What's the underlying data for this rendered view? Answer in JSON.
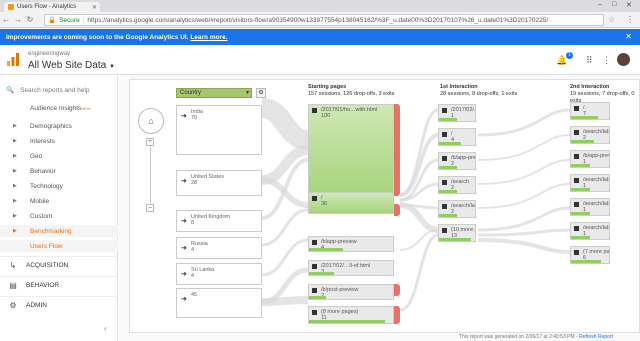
{
  "browser": {
    "tab_title": "Users Flow - Analytics",
    "secure_label": "Secure",
    "url": "https://analytics.google.com/analytics/web/#report/visitors-flow/a90354900w133977554p138045162/%3F_u.date00%3D20170107%26_u.date01%3D20170225/"
  },
  "banner": {
    "text": "Improvements are coming soon to the Google Analytics UI.",
    "link": "Learn more."
  },
  "header": {
    "account": "engineeringway",
    "property": "All Web Site Data",
    "notification_count": "1"
  },
  "sidebar": {
    "search_placeholder": "Search reports and help",
    "items": [
      {
        "label": "Audience Insights",
        "badge": "NEW"
      },
      {
        "label": "Demographics"
      },
      {
        "label": "Interests"
      },
      {
        "label": "Geo"
      },
      {
        "label": "Behavior"
      },
      {
        "label": "Technology"
      },
      {
        "label": "Mobile"
      },
      {
        "label": "Custom"
      },
      {
        "label": "Benchmarking"
      },
      {
        "label": "Users Flow"
      }
    ],
    "sections": [
      {
        "label": "ACQUISITION"
      },
      {
        "label": "BEHAVIOR"
      },
      {
        "label": "ADMIN"
      }
    ]
  },
  "flow": {
    "dimension": "Country",
    "countries": [
      {
        "name": "India",
        "value": "70"
      },
      {
        "name": "United States",
        "value": "28"
      },
      {
        "name": "United Kingdom",
        "value": "8"
      },
      {
        "name": "Russia",
        "value": "4"
      },
      {
        "name": "Sri Lanka",
        "value": "4"
      },
      {
        "name": "",
        "value": "45"
      }
    ],
    "starting": {
      "title": "Starting pages",
      "stats": "157 sessions, 126 drop-offs, 3 exits",
      "nodes": [
        {
          "label": "/2017/01/ho…with.html",
          "value": "100"
        },
        {
          "label": "/",
          "value": "36"
        },
        {
          "label": "/blapp-preview",
          "value": "4"
        },
        {
          "label": "/2017/02/…ll-of.html",
          "value": "3"
        },
        {
          "label": "/b/post-preview",
          "value": "2"
        },
        {
          "label": "(8 more pages)",
          "value": "11"
        }
      ]
    },
    "first": {
      "title": "1st Interaction",
      "stats": "28 sessions, 8 drop-offs, 1 exits",
      "nodes": [
        {
          "label": "/2017/02/…ll-of.html",
          "value": "1"
        },
        {
          "label": "/",
          "value": "4"
        },
        {
          "label": "/b/app-preview",
          "value": "2"
        },
        {
          "label": "/search",
          "value": "2"
        },
        {
          "label": "/search/lab…technology",
          "value": "2"
        },
        {
          "label": "(10 more pages)",
          "value": "13"
        }
      ]
    },
    "second": {
      "title": "2nd Interaction",
      "stats": "19 sessions, 7 drop-offs, 0 exits",
      "nodes": [
        {
          "label": "/",
          "value": "7"
        },
        {
          "label": "/search/lab…techno",
          "value": "2"
        },
        {
          "label": "/b/app-preview",
          "value": "1"
        },
        {
          "label": "/search/lab…ology.h",
          "value": "1"
        },
        {
          "label": "/search/lab…/tutoria",
          "value": "1"
        },
        {
          "label": "/search/lab…nd and",
          "value": "1"
        },
        {
          "label": "(7 more pages)",
          "value": "6"
        }
      ]
    },
    "footer_text": "This report was generated on 2/26/17 at 2:40:53 PM -",
    "footer_link": "Refresh Report"
  },
  "colors": {
    "accent": "#e8710a",
    "banner": "#1a73e8",
    "green": "#8fce5f",
    "dropoff": "#e57368"
  }
}
